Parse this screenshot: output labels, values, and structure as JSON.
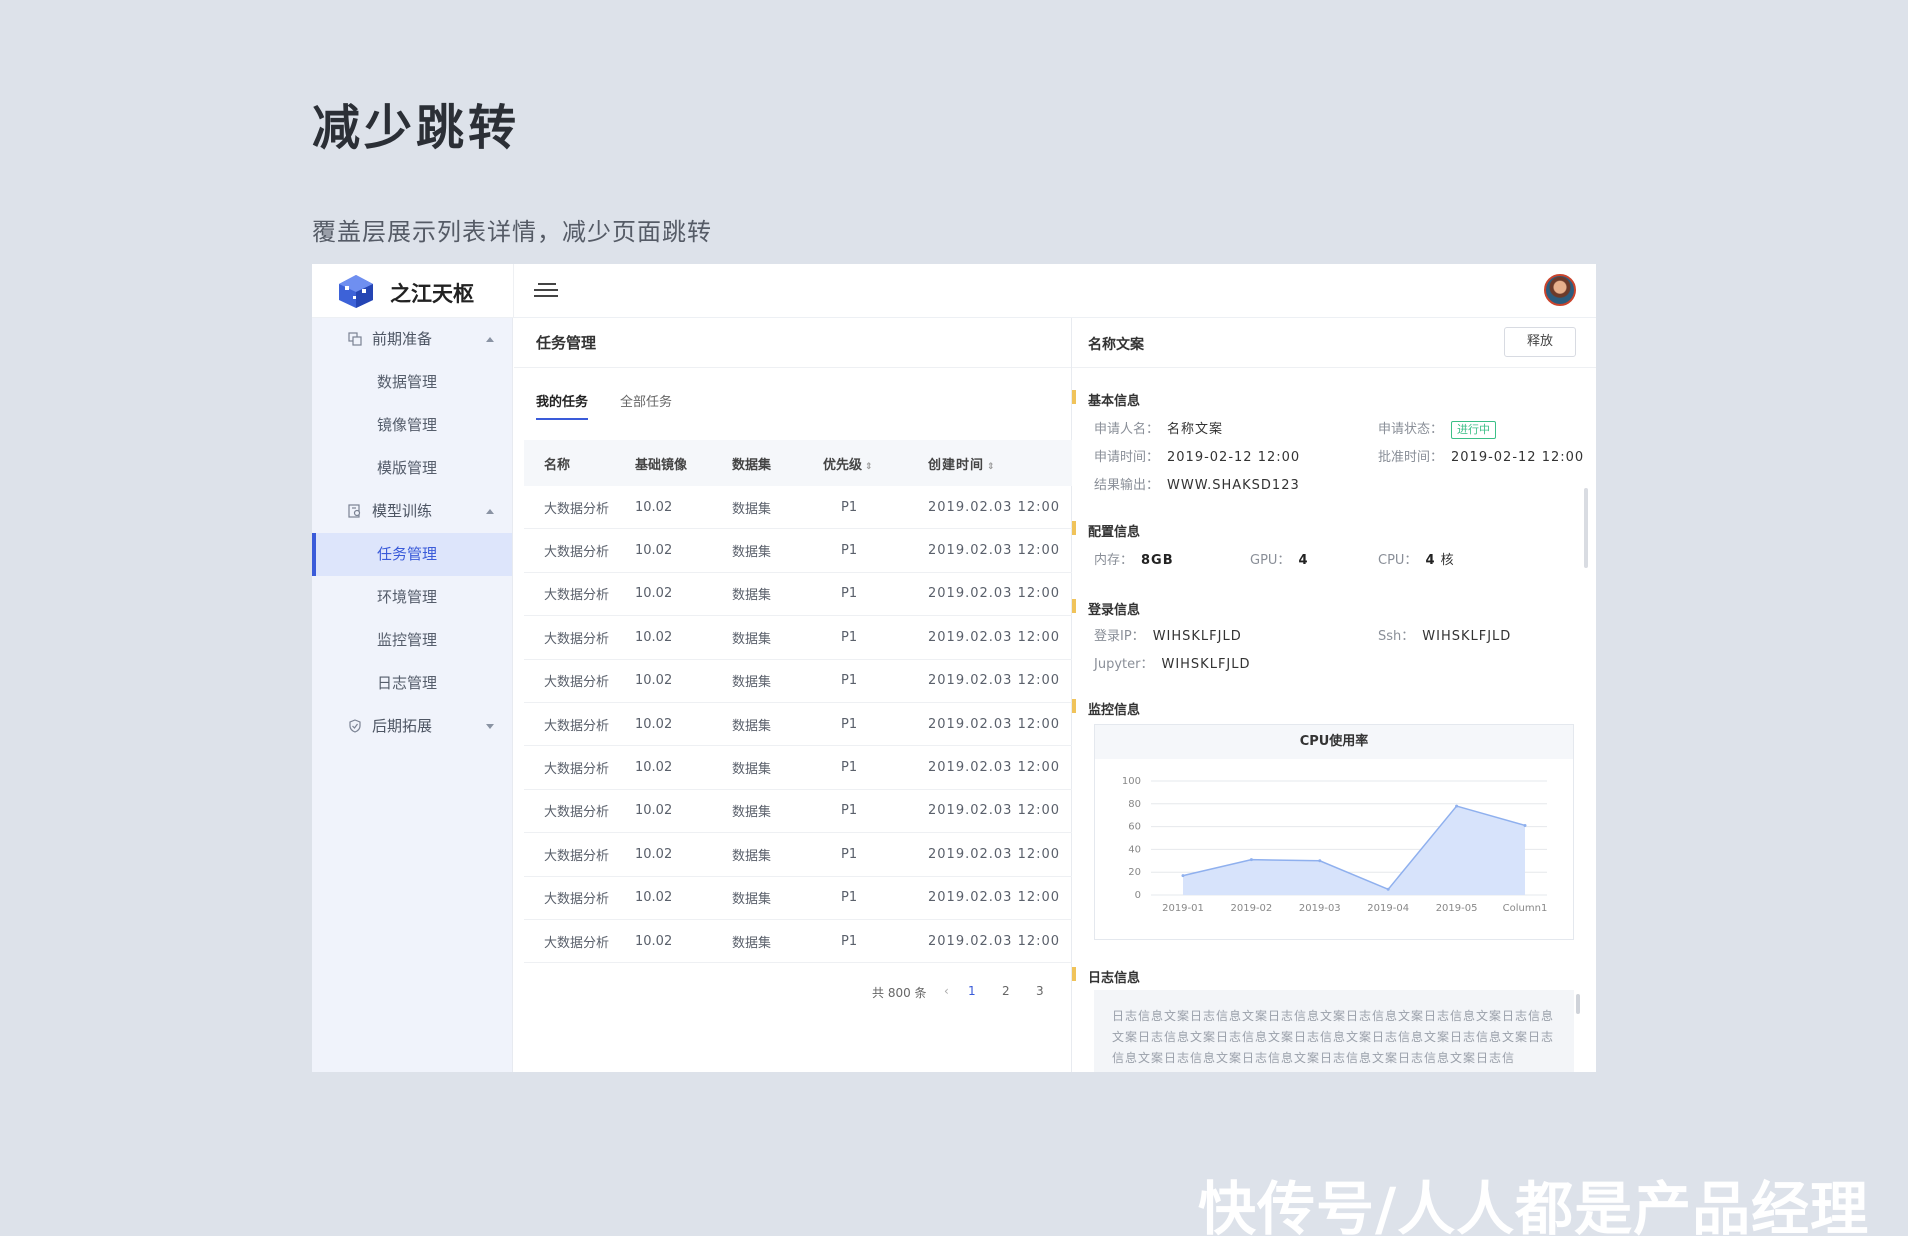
{
  "heading": "减少跳转",
  "subheading": "覆盖层展示列表详情，减少页面跳转",
  "watermark": "快传号/人人都是产品经理",
  "app": {
    "brand": "之江天枢",
    "icons": {
      "menu": "hamburger-menu-icon",
      "avatar": "user-avatar"
    }
  },
  "sidebar": {
    "groups": [
      {
        "label": "前期准备",
        "icon": "copy-icon",
        "expanded": true,
        "items": [
          "数据管理",
          "镜像管理",
          "模版管理"
        ]
      },
      {
        "label": "模型训练",
        "icon": "document-search-icon",
        "expanded": true,
        "items": [
          "任务管理",
          "环境管理",
          "监控管理",
          "日志管理"
        ]
      },
      {
        "label": "后期拓展",
        "icon": "shield-check-icon",
        "expanded": false,
        "items": []
      }
    ],
    "active_item": "任务管理",
    "accent": "#3a5bd9"
  },
  "task_panel": {
    "title": "任务管理",
    "tabs": [
      "我的任务",
      "全部任务"
    ],
    "active_tab": "我的任务",
    "columns": [
      "名称",
      "基础镜像",
      "数据集",
      "优先级",
      "创建时间"
    ],
    "sortable_columns": [
      "优先级",
      "创建时间"
    ],
    "rows": [
      [
        "大数据分析",
        "10.02",
        "数据集",
        "P1",
        "2019.02.03 12:00"
      ],
      [
        "大数据分析",
        "10.02",
        "数据集",
        "P1",
        "2019.02.03 12:00"
      ],
      [
        "大数据分析",
        "10.02",
        "数据集",
        "P1",
        "2019.02.03 12:00"
      ],
      [
        "大数据分析",
        "10.02",
        "数据集",
        "P1",
        "2019.02.03 12:00"
      ],
      [
        "大数据分析",
        "10.02",
        "数据集",
        "P1",
        "2019.02.03 12:00"
      ],
      [
        "大数据分析",
        "10.02",
        "数据集",
        "P1",
        "2019.02.03 12:00"
      ],
      [
        "大数据分析",
        "10.02",
        "数据集",
        "P1",
        "2019.02.03 12:00"
      ],
      [
        "大数据分析",
        "10.02",
        "数据集",
        "P1",
        "2019.02.03 12:00"
      ],
      [
        "大数据分析",
        "10.02",
        "数据集",
        "P1",
        "2019.02.03 12:00"
      ],
      [
        "大数据分析",
        "10.02",
        "数据集",
        "P1",
        "2019.02.03 12:00"
      ],
      [
        "大数据分析",
        "10.02",
        "数据集",
        "P1",
        "2019.02.03 12:00"
      ]
    ],
    "pagination": {
      "total": "共 800 条",
      "pages": [
        "1",
        "2",
        "3"
      ],
      "current": "1"
    }
  },
  "detail": {
    "title": "名称文案",
    "release_button": "释放",
    "basic": {
      "section": "基本信息",
      "applicant_label": "申请人名：",
      "applicant": "名称文案",
      "status_label": "申请状态：",
      "status": "进行中",
      "status_color": "#3cbf87",
      "apply_time_label": "申请时间：",
      "apply_time": "2019-02-12 12:00",
      "approve_time_label": "批准时间：",
      "approve_time": "2019-02-12 12:00",
      "output_label": "结果输出：",
      "output": "WWW.SHAKSD123"
    },
    "config": {
      "section": "配置信息",
      "memory_label": "内存：",
      "memory": "8GB",
      "gpu_label": "GPU：",
      "gpu": "4",
      "cpu_label": "CPU：",
      "cpu": "4",
      "cpu_unit": "核"
    },
    "login": {
      "section": "登录信息",
      "ip_label": "登录IP：",
      "ip": "WIHSKLFJLD",
      "ssh_label": "Ssh：",
      "ssh": "WIHSKLFJLD",
      "jupyter_label": "Jupyter：",
      "jupyter": "WIHSKLFJLD"
    },
    "monitor": {
      "section": "监控信息"
    },
    "log": {
      "section": "日志信息",
      "text": "日志信息文案日志信息文案日志信息文案日志信息文案日志信息文案日志信息文案日志信息文案日志信息文案日志信息文案日志信息文案日志信息文案日志信息文案日志信息文案日志信息文案日志信息文案日志信息文案日志信"
    },
    "section_marker_color": "#f0c35a"
  },
  "chart_data": {
    "type": "area",
    "title": "CPU使用率",
    "categories": [
      "2019-01",
      "2019-02",
      "2019-03",
      "2019-04",
      "2019-05",
      "Column1"
    ],
    "values": [
      17,
      31,
      30,
      5,
      78,
      61
    ],
    "ylim": [
      0,
      100
    ],
    "yticks": [
      0,
      20,
      40,
      60,
      80,
      100
    ],
    "grid": true,
    "fill_color": "#d7e3fb",
    "line_color": "#8fb0ee"
  }
}
